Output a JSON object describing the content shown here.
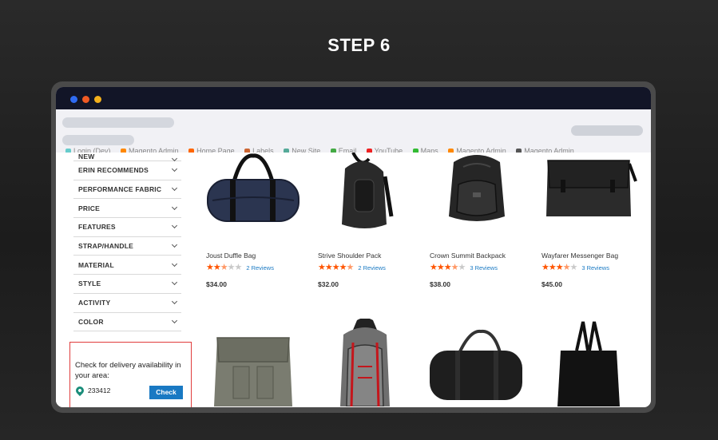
{
  "step": {
    "title": "STEP 6"
  },
  "browser": {
    "window_controls": [
      "close-dot",
      "minimize-dot",
      "maximize-dot"
    ],
    "bookmarks": [
      "Login (Dev)",
      "Magento Admin",
      "Home Page",
      "Labels",
      "New Site",
      "Email",
      "YouTube",
      "Maps",
      "Magento Admin",
      "Magento Admin"
    ]
  },
  "sidebar": {
    "filters": [
      {
        "label": "NEW"
      },
      {
        "label": "ERIN RECOMMENDS"
      },
      {
        "label": "PERFORMANCE FABRIC"
      },
      {
        "label": "PRICE"
      },
      {
        "label": "FEATURES"
      },
      {
        "label": "STRAP/HANDLE"
      },
      {
        "label": "MATERIAL"
      },
      {
        "label": "STYLE"
      },
      {
        "label": "ACTIVITY"
      },
      {
        "label": "COLOR"
      }
    ]
  },
  "delivery": {
    "text": "Check for delivery availability in your area:",
    "pincode": "233412",
    "button_label": "Check",
    "pin_color": "#1a8d7a",
    "button_color": "#1979c3"
  },
  "products": [
    {
      "name": "Joust Duffle Bag",
      "rating": 2.5,
      "reviews": "2  Reviews",
      "price": "$34.00",
      "icon": "duffle-bag-navy"
    },
    {
      "name": "Strive Shoulder Pack",
      "rating": 4.5,
      "reviews": "2  Reviews",
      "price": "$32.00",
      "icon": "sling-backpack-black"
    },
    {
      "name": "Crown Summit Backpack",
      "rating": 3.5,
      "reviews": "3  Reviews",
      "price": "$38.00",
      "icon": "backpack-black"
    },
    {
      "name": "Wayfarer Messenger Bag",
      "rating": 3.5,
      "reviews": "3  Reviews",
      "price": "$45.00",
      "icon": "messenger-bag-black"
    },
    {
      "icon": "messenger-bag-gray"
    },
    {
      "icon": "backpack-red-gray"
    },
    {
      "icon": "duffle-bag-black"
    },
    {
      "icon": "tote-bag-black"
    }
  ],
  "colors": {
    "star_on": "#ff5501",
    "star_off": "#c9c9c9",
    "link": "#1979c3",
    "highlight_border": "#e03c3c"
  }
}
